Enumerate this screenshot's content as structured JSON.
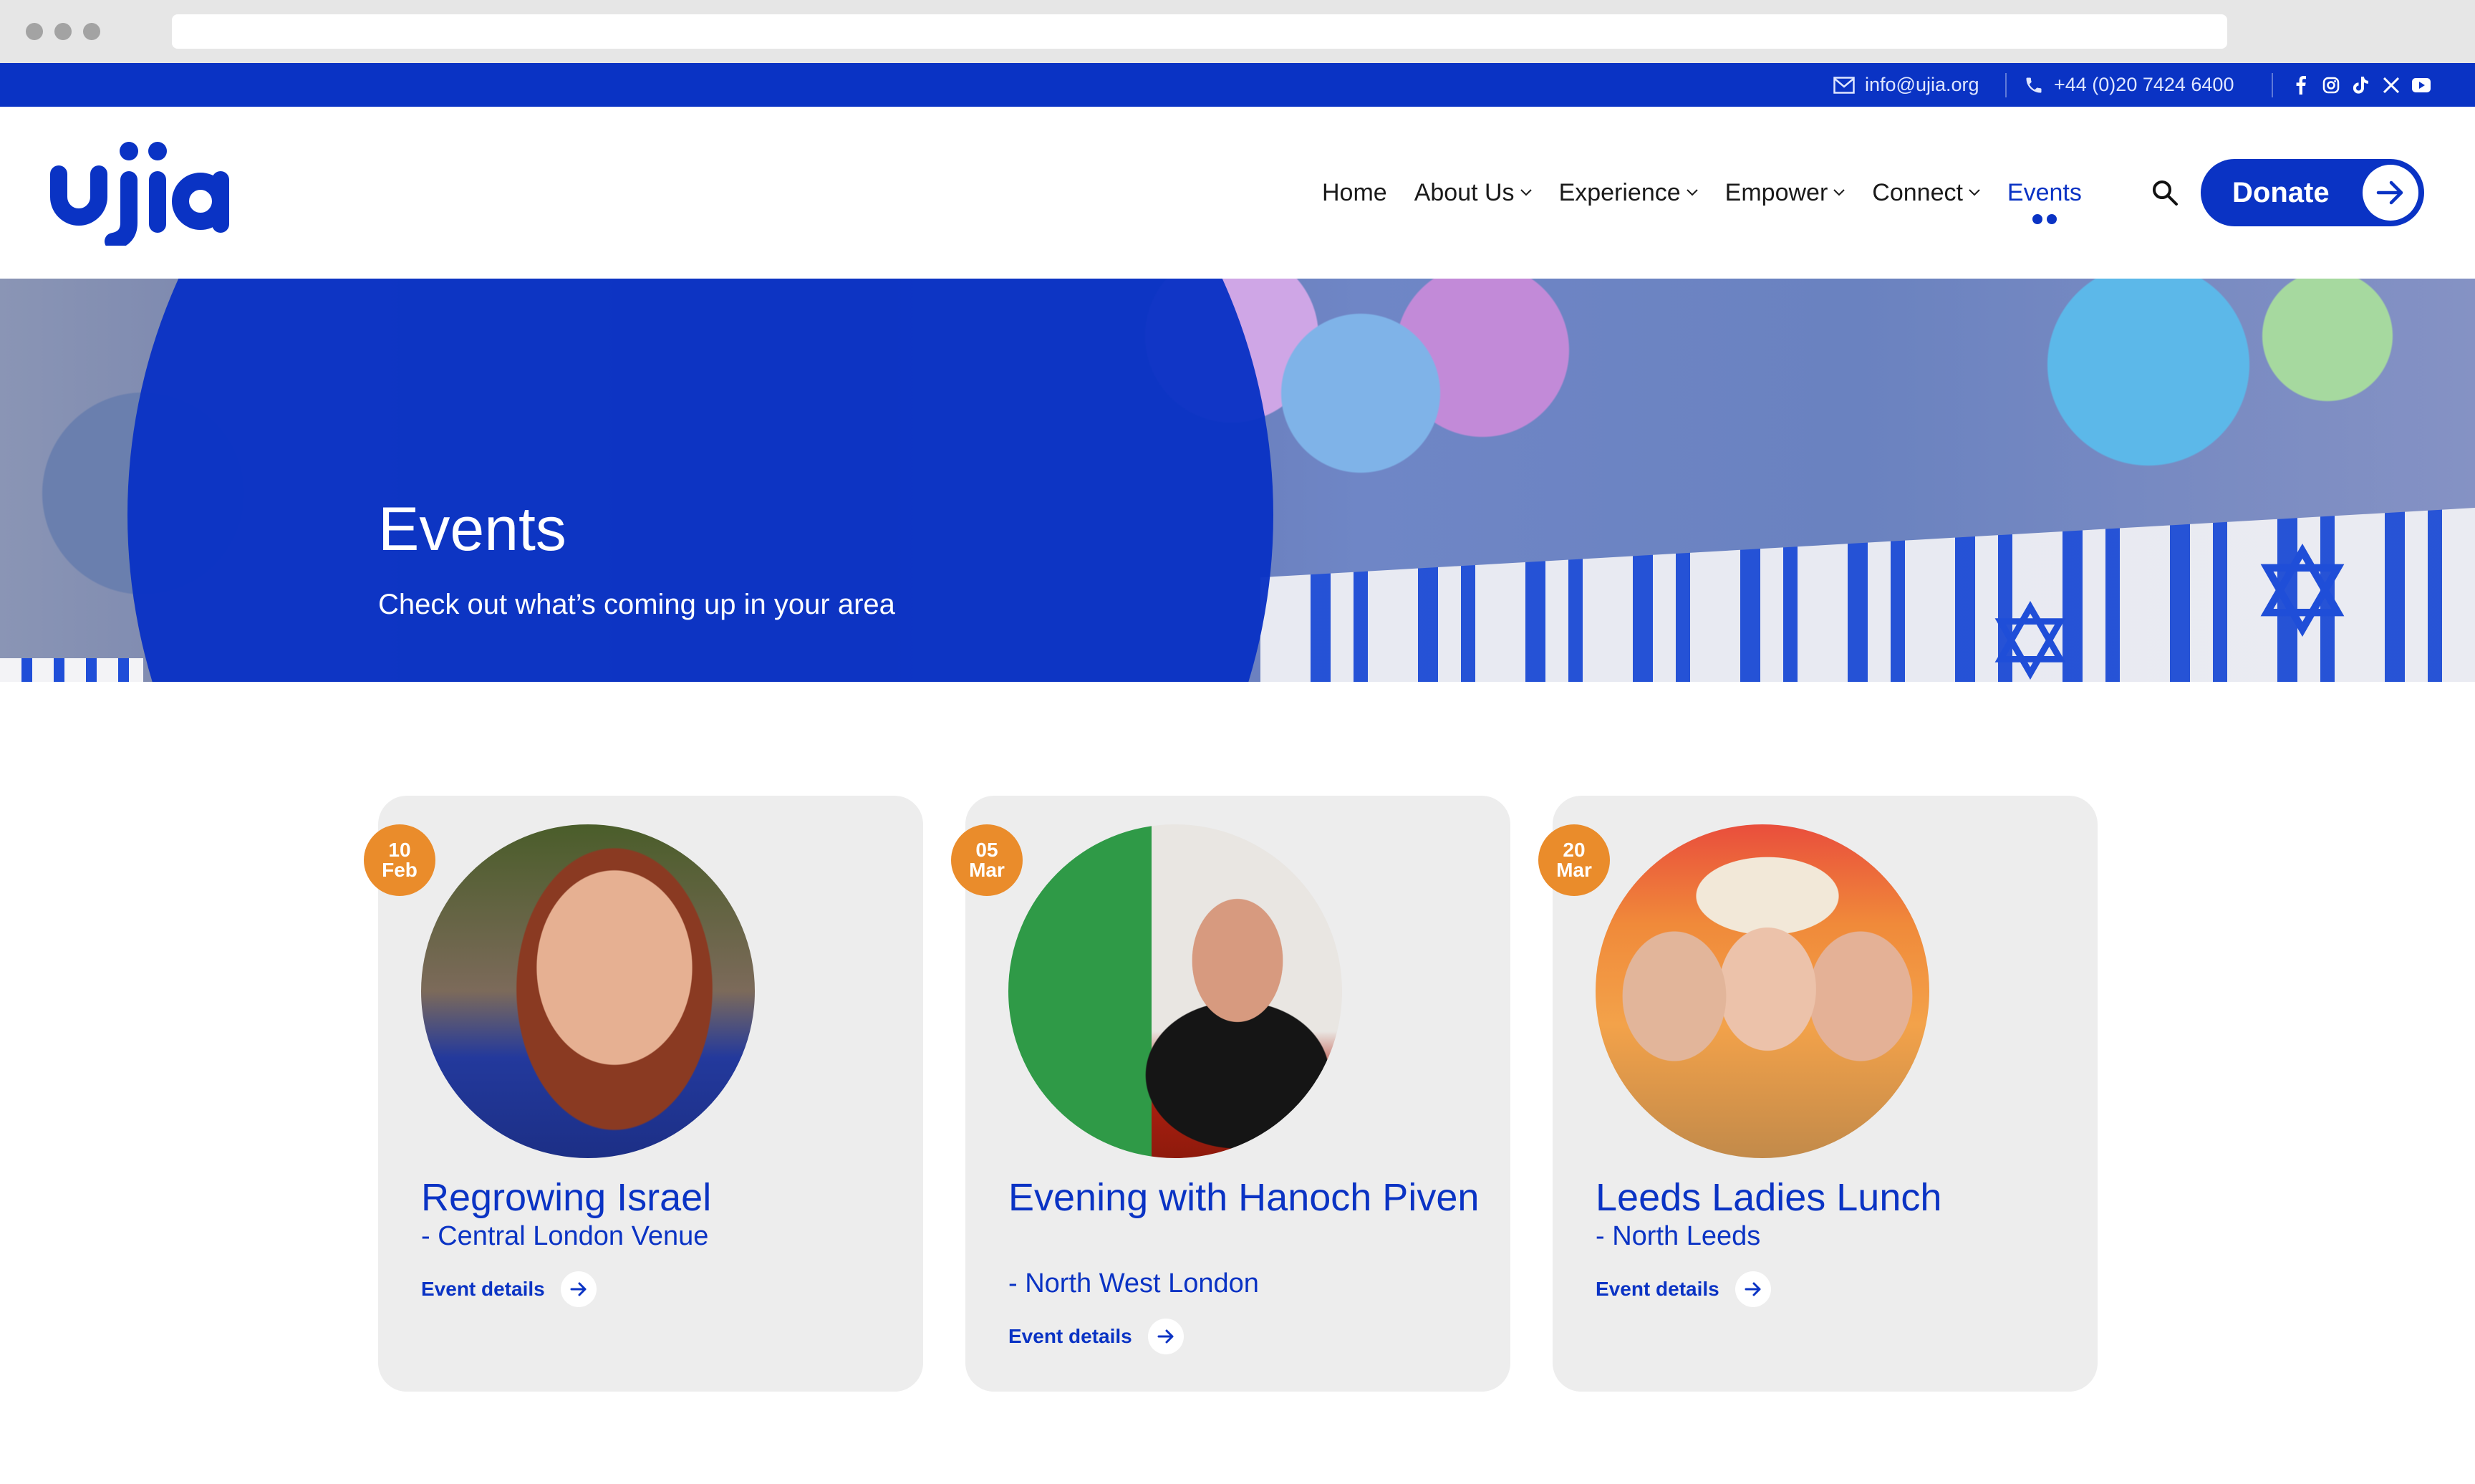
{
  "topbar": {
    "email": "info@ujia.org",
    "phone": "+44 (0)20 7424 6400",
    "social": [
      "facebook-icon",
      "instagram-icon",
      "tiktok-icon",
      "x-icon",
      "youtube-icon"
    ]
  },
  "brand": {
    "logo_text": "ujia",
    "color": "#0a33c4",
    "accent": "#ea8c2b"
  },
  "nav": {
    "items": [
      {
        "label": "Home",
        "dropdown": false
      },
      {
        "label": "About Us",
        "dropdown": true
      },
      {
        "label": "Experience",
        "dropdown": true
      },
      {
        "label": "Empower",
        "dropdown": true
      },
      {
        "label": "Connect",
        "dropdown": true
      },
      {
        "label": "Events",
        "dropdown": false,
        "active": true
      }
    ],
    "donate_label": "Donate"
  },
  "hero": {
    "title": "Events",
    "subtitle": "Check out what’s coming up in your area"
  },
  "events": [
    {
      "day": "10",
      "month": "Feb",
      "title": "Regrowing Israel",
      "location": "- Central London Venue",
      "details_label": "Event details"
    },
    {
      "day": "05",
      "month": "Mar",
      "title": "Evening with Hanoch Piven",
      "location": "- North West London",
      "details_label": "Event details"
    },
    {
      "day": "20",
      "month": "Mar",
      "title": "Leeds Ladies Lunch",
      "location": "- North Leeds",
      "details_label": "Event details"
    }
  ]
}
